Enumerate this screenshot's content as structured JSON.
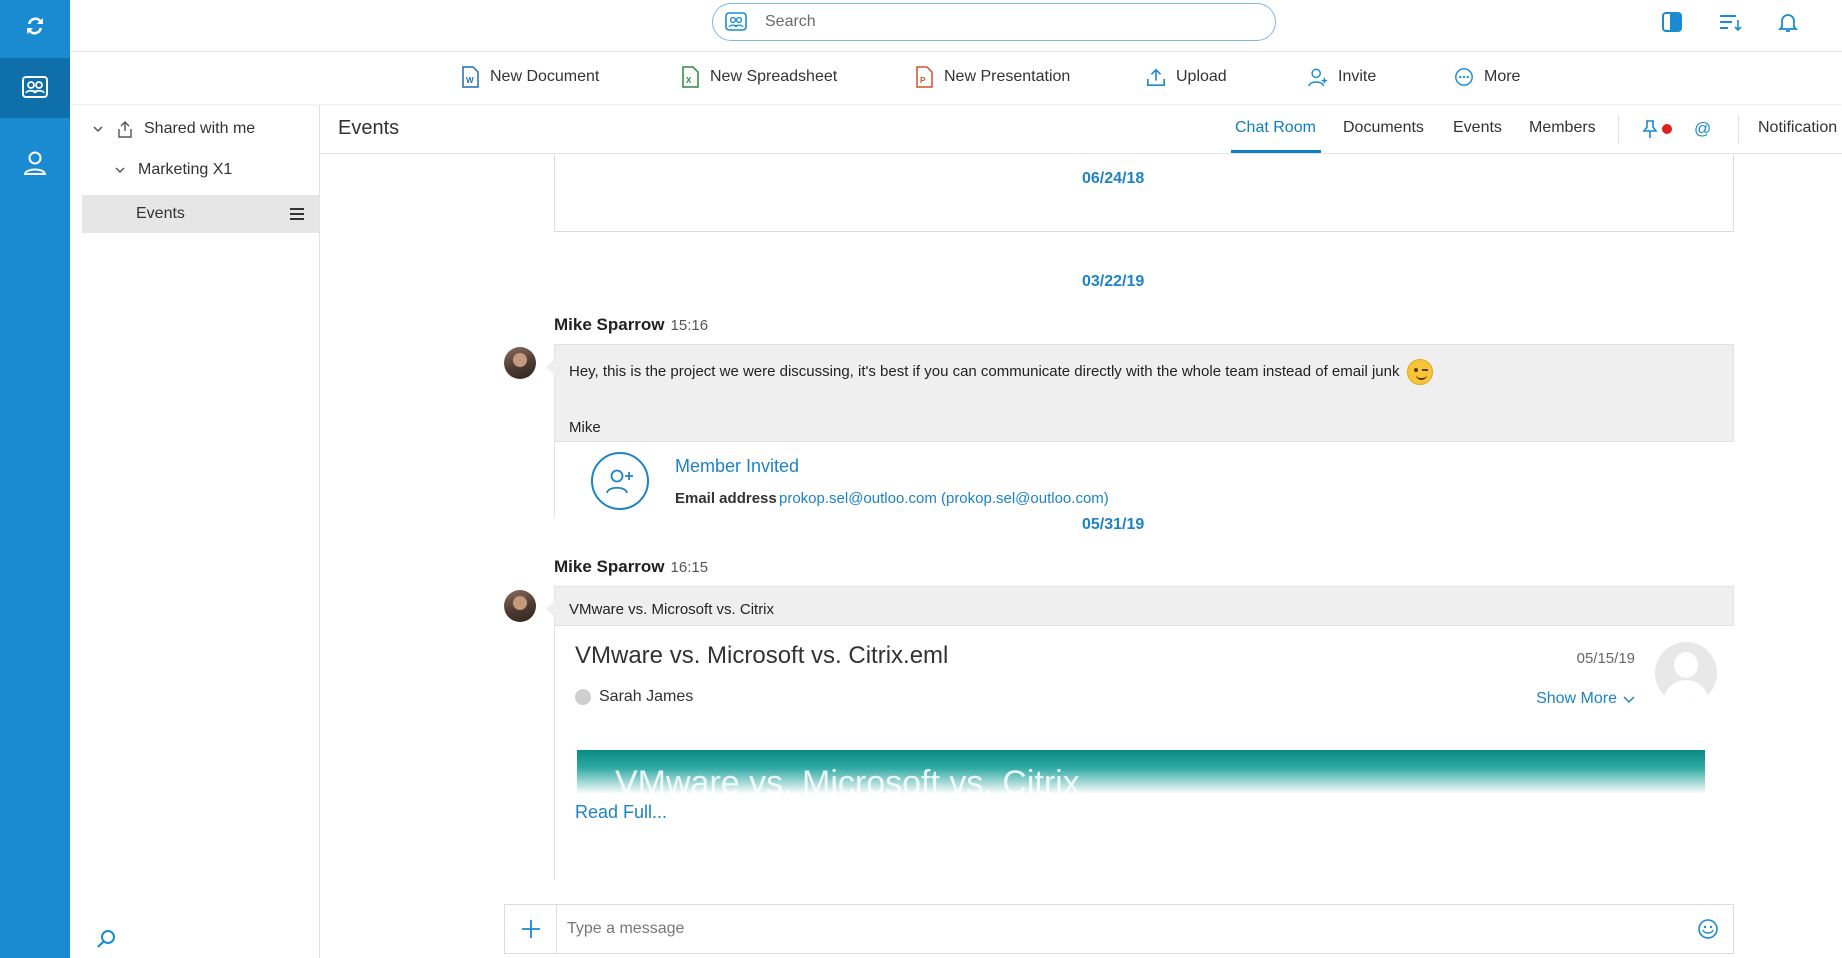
{
  "search": {
    "placeholder": "Search"
  },
  "toolbar": {
    "new_document": "New Document",
    "new_spreadsheet": "New Spreadsheet",
    "new_presentation": "New Presentation",
    "upload": "Upload",
    "invite": "Invite",
    "more": "More"
  },
  "tree": {
    "root": "Shared with me",
    "folder": "Marketing X1",
    "selected": "Events"
  },
  "main": {
    "title": "Events",
    "tabs": [
      "Chat Room",
      "Documents",
      "Events",
      "Members"
    ],
    "notification_label": "Notification",
    "at_symbol": "@"
  },
  "chat": {
    "dates": [
      "06/24/18",
      "03/22/19",
      "05/31/19"
    ],
    "message1": {
      "author": "Mike Sparrow",
      "time": "15:16",
      "text": "Hey, this is the project we were discussing, it's best if you can communicate directly with the whole team instead of email junk",
      "signature": "Mike",
      "event_title": "Member Invited",
      "email_label": "Email address",
      "email_value": "prokop.sel@outloo.com (prokop.sel@outloo.com)"
    },
    "message2": {
      "author": "Mike Sparrow",
      "time": "16:15",
      "text": "VMware vs. Microsoft vs. Citrix",
      "mail_subject": "VMware vs. Microsoft vs. Citrix.eml",
      "mail_date": "05/15/19",
      "sender": "Sarah James",
      "show_more": "Show More",
      "banner_text": "VMware vs. Microsoft vs. Citrix",
      "read_full": "Read Full..."
    }
  },
  "composer": {
    "placeholder": "Type a message"
  },
  "colors": {
    "accent": "#1e83c6",
    "rail": "#1a8bd1",
    "rail_active": "#0f6fab",
    "notify_dot": "#e02020"
  },
  "icons": [
    "sync-icon",
    "rooms-icon",
    "user-icon",
    "search-rail-icon",
    "panel-icon",
    "sort-icon",
    "bell-icon",
    "pin-icon",
    "emoji-icon",
    "plus-icon"
  ]
}
